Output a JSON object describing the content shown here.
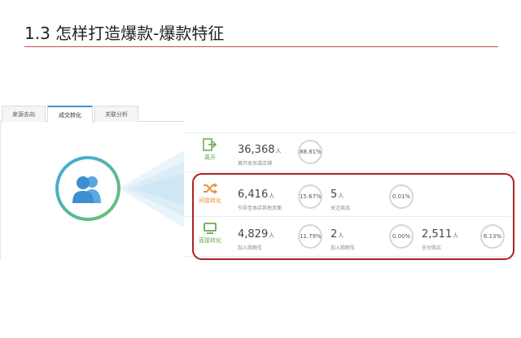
{
  "slide": {
    "title": "1.3 怎样打造爆款-爆款特征"
  },
  "tabs": [
    {
      "label": "来源去向",
      "active": false
    },
    {
      "label": "成交转化",
      "active": true
    },
    {
      "label": "关联分析",
      "active": false
    }
  ],
  "colors": {
    "accent_red": "#b22222",
    "green": "#6aa84f",
    "orange": "#e9923a",
    "blue": "#3fa9e6"
  },
  "rows": [
    {
      "name": "离开",
      "icon": "exit-arrow-icon",
      "metrics": [
        {
          "value": "36,368",
          "unit": "人",
          "desc": "离开本页或店铺",
          "pct": "88.81%"
        }
      ]
    },
    {
      "name": "间接转化",
      "icon": "shuffle-icon",
      "metrics": [
        {
          "value": "6,416",
          "unit": "人",
          "desc": "引导至本店其他页面",
          "pct": "15.67%"
        },
        {
          "value": "5",
          "unit": "人",
          "desc": "关注商品",
          "pct": "0.01%"
        }
      ]
    },
    {
      "name": "直接转化",
      "icon": "screen-icon",
      "metrics": [
        {
          "value": "4,829",
          "unit": "人",
          "desc": "加入购物车",
          "pct": "11.79%"
        },
        {
          "value": "2",
          "unit": "人",
          "desc": "加入购物车",
          "pct": "0.00%"
        },
        {
          "value": "2,511",
          "unit": "人",
          "desc": "支付购买",
          "pct": "6.13%"
        }
      ]
    }
  ]
}
